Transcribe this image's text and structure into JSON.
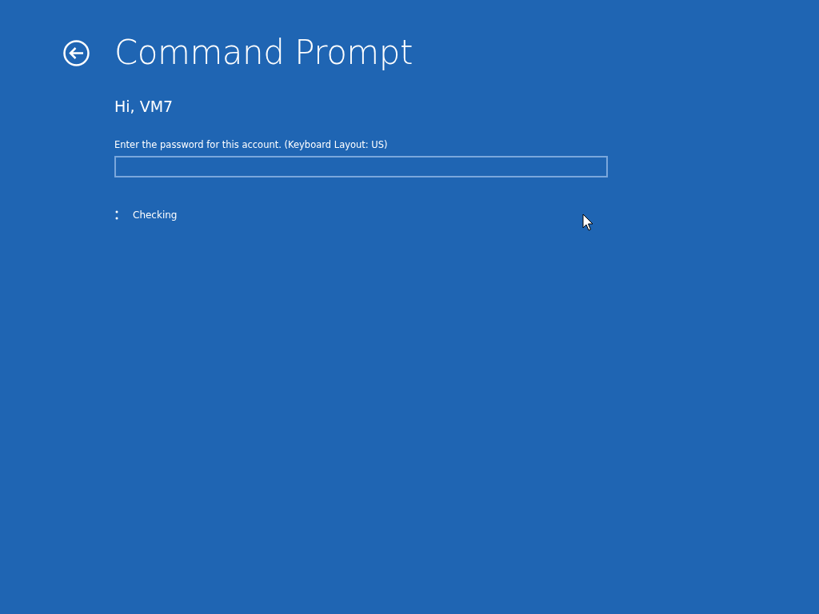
{
  "title": "Command Prompt",
  "greeting": "Hi, VM7",
  "password": {
    "label": "Enter the password for this account. (Keyboard Layout: US)"
  },
  "status": {
    "text": "Checking"
  }
}
